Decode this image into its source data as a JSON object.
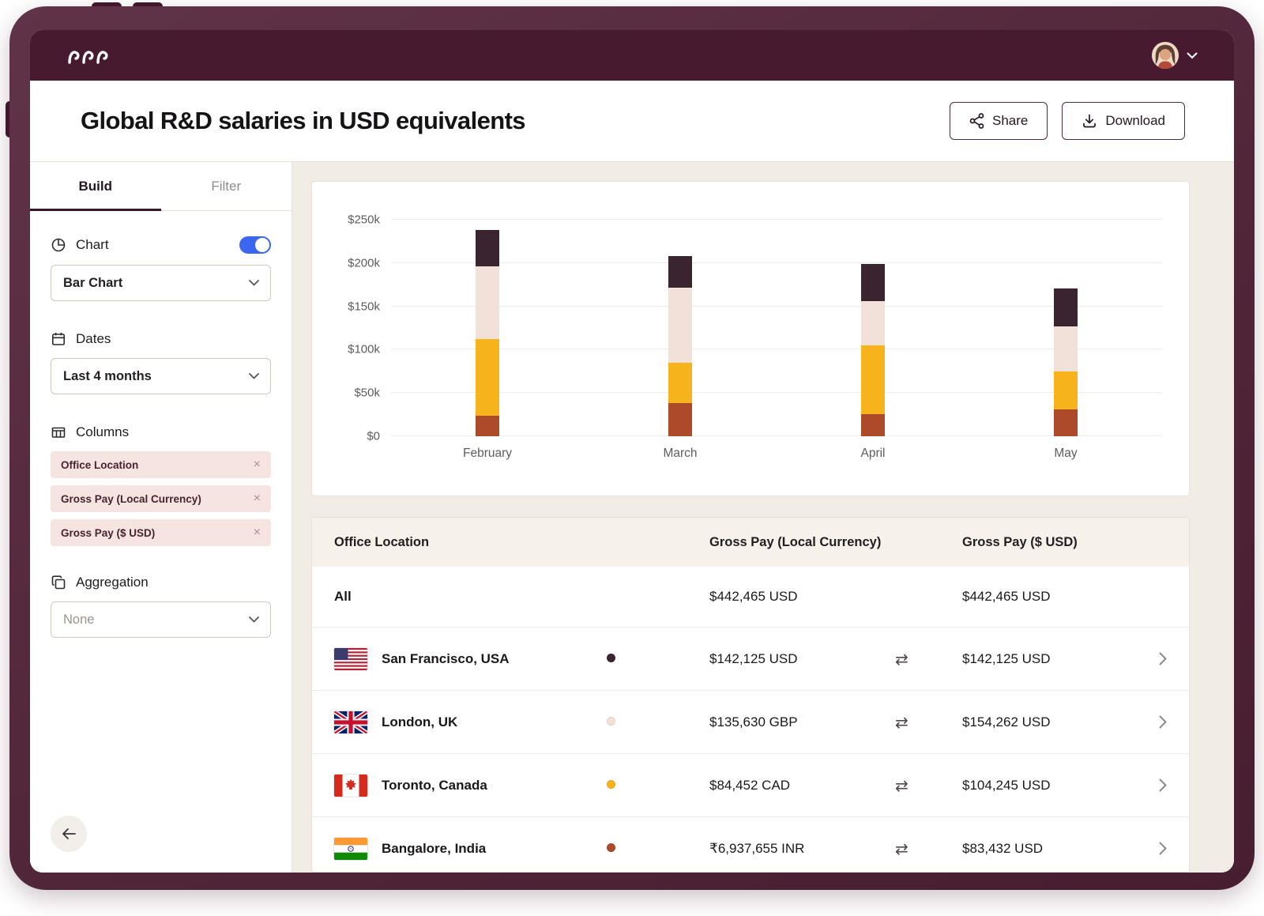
{
  "colors": {
    "frame": "#522639",
    "topbar": "#471a30",
    "canvas": "#f1ece4",
    "accent_toggle": "#3a66f0",
    "brand_border": "#4d2a3d",
    "chip_bg": "#f6e4e1"
  },
  "header": {
    "title": "Global R&D salaries in USD equivalents",
    "share_label": "Share",
    "download_label": "Download"
  },
  "sidebar": {
    "tabs": [
      {
        "label": "Build",
        "active": true
      },
      {
        "label": "Filter",
        "active": false
      }
    ],
    "chart_section": {
      "label": "Chart",
      "toggle_on": true,
      "value": "Bar Chart"
    },
    "dates_section": {
      "label": "Dates",
      "value": "Last 4 months"
    },
    "columns_section": {
      "label": "Columns",
      "chips": [
        "Office Location",
        "Gross Pay (Local Currency)",
        "Gross Pay ($ USD)"
      ]
    },
    "aggregation_section": {
      "label": "Aggregation",
      "value": "None"
    }
  },
  "chart_data": {
    "type": "bar",
    "stacked": true,
    "order": "series listed bottom-to-top",
    "categories": [
      "February",
      "March",
      "April",
      "May"
    ],
    "series": [
      {
        "name": "Bangalore, India",
        "color": "#ad4a2a",
        "values": [
          24,
          38,
          26,
          31
        ]
      },
      {
        "name": "Toronto, Canada",
        "color": "#f6b31b",
        "values": [
          88,
          47,
          79,
          44
        ]
      },
      {
        "name": "London, UK",
        "color": "#f2e1d8",
        "values": [
          84,
          87,
          51,
          52
        ]
      },
      {
        "name": "San Francisco, USA",
        "color": "#3a2430",
        "values": [
          42,
          36,
          43,
          44
        ]
      }
    ],
    "unit": "USD (thousands)",
    "ylim": [
      0,
      250
    ],
    "yticks": [
      {
        "label": "$0",
        "value": 0
      },
      {
        "label": "$50k",
        "value": 50
      },
      {
        "label": "$100k",
        "value": 100
      },
      {
        "label": "$150k",
        "value": 150
      },
      {
        "label": "$200k",
        "value": 200
      },
      {
        "label": "$250k",
        "value": 250
      }
    ],
    "grid": true,
    "legend_position": "none (legend dots shown in table rows)"
  },
  "table": {
    "columns": [
      "Office Location",
      "Gross Pay (Local Currency)",
      "Gross Pay ($ USD)"
    ],
    "rows": [
      {
        "location": "All",
        "flag": null,
        "dot": null,
        "local": "$442,465 USD",
        "usd": "$442,465 USD",
        "is_summary": true
      },
      {
        "location": "San Francisco, USA",
        "flag": "us",
        "dot": "#3a2430",
        "local": "$142,125 USD",
        "usd": "$142,125 USD",
        "is_summary": false
      },
      {
        "location": "London, UK",
        "flag": "uk",
        "dot": "#f2e1d8",
        "local": "$135,630 GBP",
        "usd": "$154,262 USD",
        "is_summary": false
      },
      {
        "location": "Toronto, Canada",
        "flag": "ca",
        "dot": "#f6b31b",
        "local": "$84,452 CAD",
        "usd": "$104,245 USD",
        "is_summary": false
      },
      {
        "location": "Bangalore, India",
        "flag": "in",
        "dot": "#ad4a2a",
        "local": "₹6,937,655 INR",
        "usd": "$83,432 USD",
        "is_summary": false
      }
    ]
  }
}
